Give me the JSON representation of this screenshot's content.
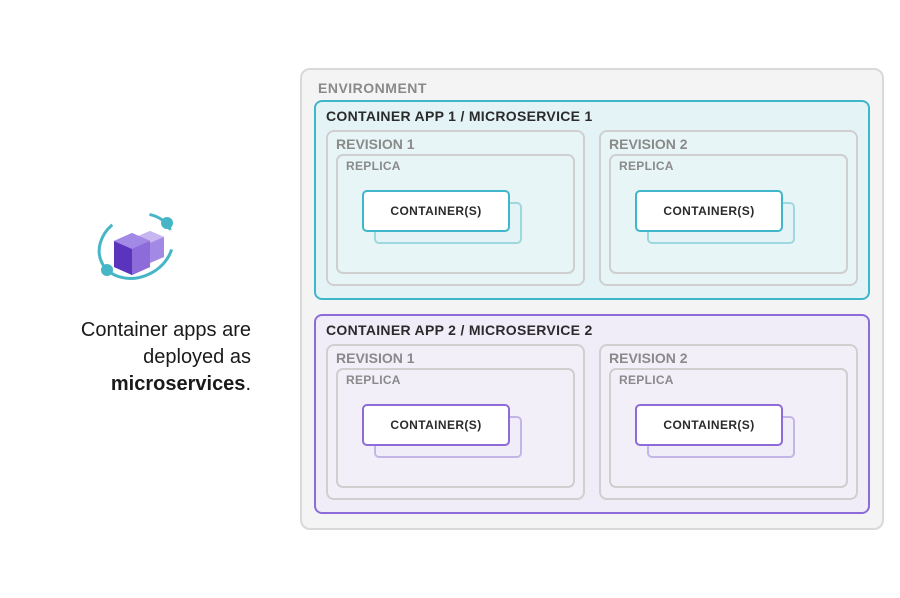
{
  "caption": {
    "line1": "Container apps are",
    "line2": "deployed as",
    "bold": "microservices",
    "suffix": "."
  },
  "environment": {
    "label": "ENVIRONMENT",
    "apps": [
      {
        "title": "CONTAINER APP 1 / MICROSERVICE 1",
        "accent": "#3fb6c9",
        "revisions": [
          {
            "title": "REVISION 1",
            "replica_label": "REPLICA",
            "container_label": "CONTAINER(S)"
          },
          {
            "title": "REVISION 2",
            "replica_label": "REPLICA",
            "container_label": "CONTAINER(S)"
          }
        ]
      },
      {
        "title": "CONTAINER APP 2 / MICROSERVICE 2",
        "accent": "#8d6cd9",
        "revisions": [
          {
            "title": "REVISION 1",
            "replica_label": "REPLICA",
            "container_label": "CONTAINER(S)"
          },
          {
            "title": "REVISION 2",
            "replica_label": "REPLICA",
            "container_label": "CONTAINER(S)"
          }
        ]
      }
    ]
  }
}
